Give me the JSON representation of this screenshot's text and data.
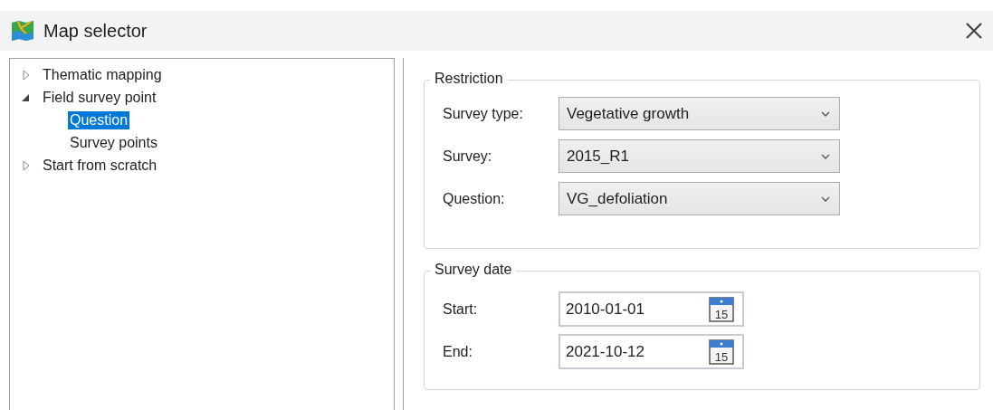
{
  "window": {
    "title": "Map selector"
  },
  "tree": [
    {
      "label": "Thematic mapping",
      "expanded": false,
      "selected": false
    },
    {
      "label": "Field survey point",
      "expanded": true,
      "selected": false,
      "children": [
        {
          "label": "Question",
          "selected": true
        },
        {
          "label": "Survey points",
          "selected": false
        }
      ]
    },
    {
      "label": "Start from scratch",
      "expanded": false,
      "selected": false
    }
  ],
  "restriction": {
    "title": "Restriction",
    "fields": [
      {
        "label": "Survey type:",
        "value": "Vegetative growth"
      },
      {
        "label": "Survey:",
        "value": "2015_R1"
      },
      {
        "label": "Question:",
        "value": "VG_defoliation"
      }
    ]
  },
  "survey_date": {
    "title": "Survey date",
    "fields": [
      {
        "label": "Start:",
        "value": "2010-01-01",
        "calendar_day": "15"
      },
      {
        "label": "End:",
        "value": "2021-10-12",
        "calendar_day": "15"
      }
    ]
  }
}
